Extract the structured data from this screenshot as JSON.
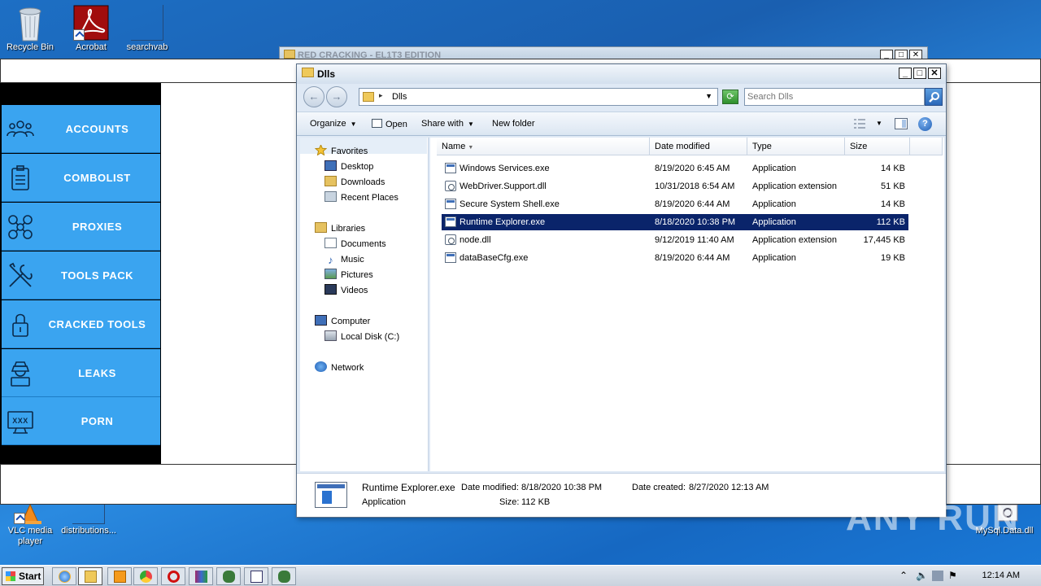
{
  "desktop": {
    "icons": [
      {
        "label": "Recycle Bin"
      },
      {
        "label": "Acrobat"
      },
      {
        "label": "searchvab"
      },
      {
        "label": "VLC media player"
      },
      {
        "label": "distributions..."
      },
      {
        "label": "MySql.Data.dll"
      }
    ]
  },
  "bg_app": {
    "title": "RED CRACKING - EL1T3 EDITION",
    "menu": [
      {
        "label": "ACCOUNTS",
        "icon": "users-icon"
      },
      {
        "label": "COMBOLIST",
        "icon": "clipboard-icon"
      },
      {
        "label": "PROXIES",
        "icon": "network-icon"
      },
      {
        "label": "TOOLS PACK",
        "icon": "tools-icon"
      },
      {
        "label": "CRACKED TOOLS",
        "icon": "lock-icon"
      },
      {
        "label": "LEAKS",
        "icon": "hacker-icon"
      },
      {
        "label": "PORN",
        "icon": "monitor-xxx-icon"
      }
    ]
  },
  "explorer": {
    "title": "Dlls",
    "address": {
      "path": "Dlls"
    },
    "search": {
      "placeholder": "Search Dlls"
    },
    "toolbar": {
      "organize": "Organize",
      "open": "Open",
      "share_with": "Share with",
      "new_folder": "New folder"
    },
    "nav": {
      "favorites": "Favorites",
      "desktop": "Desktop",
      "downloads": "Downloads",
      "recent_places": "Recent Places",
      "libraries": "Libraries",
      "documents": "Documents",
      "music": "Music",
      "pictures": "Pictures",
      "videos": "Videos",
      "computer": "Computer",
      "local_disk": "Local Disk (C:)",
      "network": "Network"
    },
    "columns": {
      "name": "Name",
      "date": "Date modified",
      "type": "Type",
      "size": "Size"
    },
    "files": [
      {
        "name": "Windows Services.exe",
        "date": "8/19/2020 6:45 AM",
        "type": "Application",
        "size": "14 KB"
      },
      {
        "name": "WebDriver.Support.dll",
        "date": "10/31/2018 6:54 AM",
        "type": "Application extension",
        "size": "51 KB"
      },
      {
        "name": "Secure System Shell.exe",
        "date": "8/19/2020 6:44 AM",
        "type": "Application",
        "size": "14 KB"
      },
      {
        "name": "Runtime Explorer.exe",
        "date": "8/18/2020 10:38 PM",
        "type": "Application",
        "size": "112 KB"
      },
      {
        "name": "node.dll",
        "date": "9/12/2019 11:40 AM",
        "type": "Application extension",
        "size": "17,445 KB"
      },
      {
        "name": "dataBaseCfg.exe",
        "date": "8/19/2020 6:44 AM",
        "type": "Application",
        "size": "19 KB"
      }
    ],
    "details": {
      "name": "Runtime Explorer.exe",
      "type": "Application",
      "date_modified_label": "Date modified:",
      "date_modified": "8/18/2020 10:38 PM",
      "date_created_label": "Date created:",
      "date_created": "8/27/2020 12:13 AM",
      "size_label": "Size:",
      "size": "112 KB"
    }
  },
  "taskbar": {
    "start": "Start",
    "clock": "12:14 AM"
  },
  "watermark": "ANY RUN"
}
